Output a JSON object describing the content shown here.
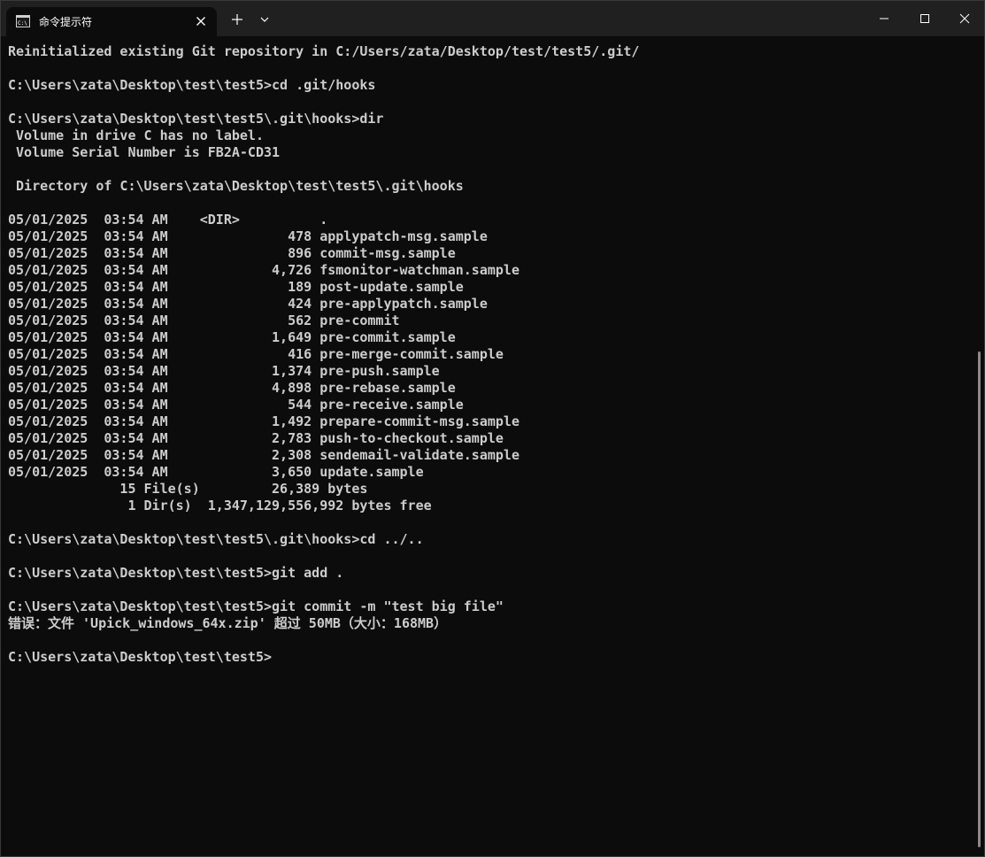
{
  "window": {
    "tab_title": "命令提示符",
    "tab_icon": "cmd-icon"
  },
  "terminal": {
    "lines": [
      "Reinitialized existing Git repository in C:/Users/zata/Desktop/test/test5/.git/",
      "",
      "C:\\Users\\zata\\Desktop\\test\\test5>cd .git/hooks",
      "",
      "C:\\Users\\zata\\Desktop\\test\\test5\\.git\\hooks>dir",
      " Volume in drive C has no label.",
      " Volume Serial Number is FB2A-CD31",
      "",
      " Directory of C:\\Users\\zata\\Desktop\\test\\test5\\.git\\hooks",
      "",
      "05/01/2025  03:54 AM    <DIR>          .",
      "05/01/2025  03:54 AM               478 applypatch-msg.sample",
      "05/01/2025  03:54 AM               896 commit-msg.sample",
      "05/01/2025  03:54 AM             4,726 fsmonitor-watchman.sample",
      "05/01/2025  03:54 AM               189 post-update.sample",
      "05/01/2025  03:54 AM               424 pre-applypatch.sample",
      "05/01/2025  03:54 AM               562 pre-commit",
      "05/01/2025  03:54 AM             1,649 pre-commit.sample",
      "05/01/2025  03:54 AM               416 pre-merge-commit.sample",
      "05/01/2025  03:54 AM             1,374 pre-push.sample",
      "05/01/2025  03:54 AM             4,898 pre-rebase.sample",
      "05/01/2025  03:54 AM               544 pre-receive.sample",
      "05/01/2025  03:54 AM             1,492 prepare-commit-msg.sample",
      "05/01/2025  03:54 AM             2,783 push-to-checkout.sample",
      "05/01/2025  03:54 AM             2,308 sendemail-validate.sample",
      "05/01/2025  03:54 AM             3,650 update.sample",
      "              15 File(s)         26,389 bytes",
      "               1 Dir(s)  1,347,129,556,992 bytes free",
      "",
      "C:\\Users\\zata\\Desktop\\test\\test5\\.git\\hooks>cd ../..",
      "",
      "C:\\Users\\zata\\Desktop\\test\\test5>git add .",
      "",
      "C:\\Users\\zata\\Desktop\\test\\test5>git commit -m \"test big file\"",
      "错误：文件 'Upick_windows_64x.zip' 超过 50MB（大小：168MB）",
      "",
      "C:\\Users\\zata\\Desktop\\test\\test5>"
    ]
  }
}
